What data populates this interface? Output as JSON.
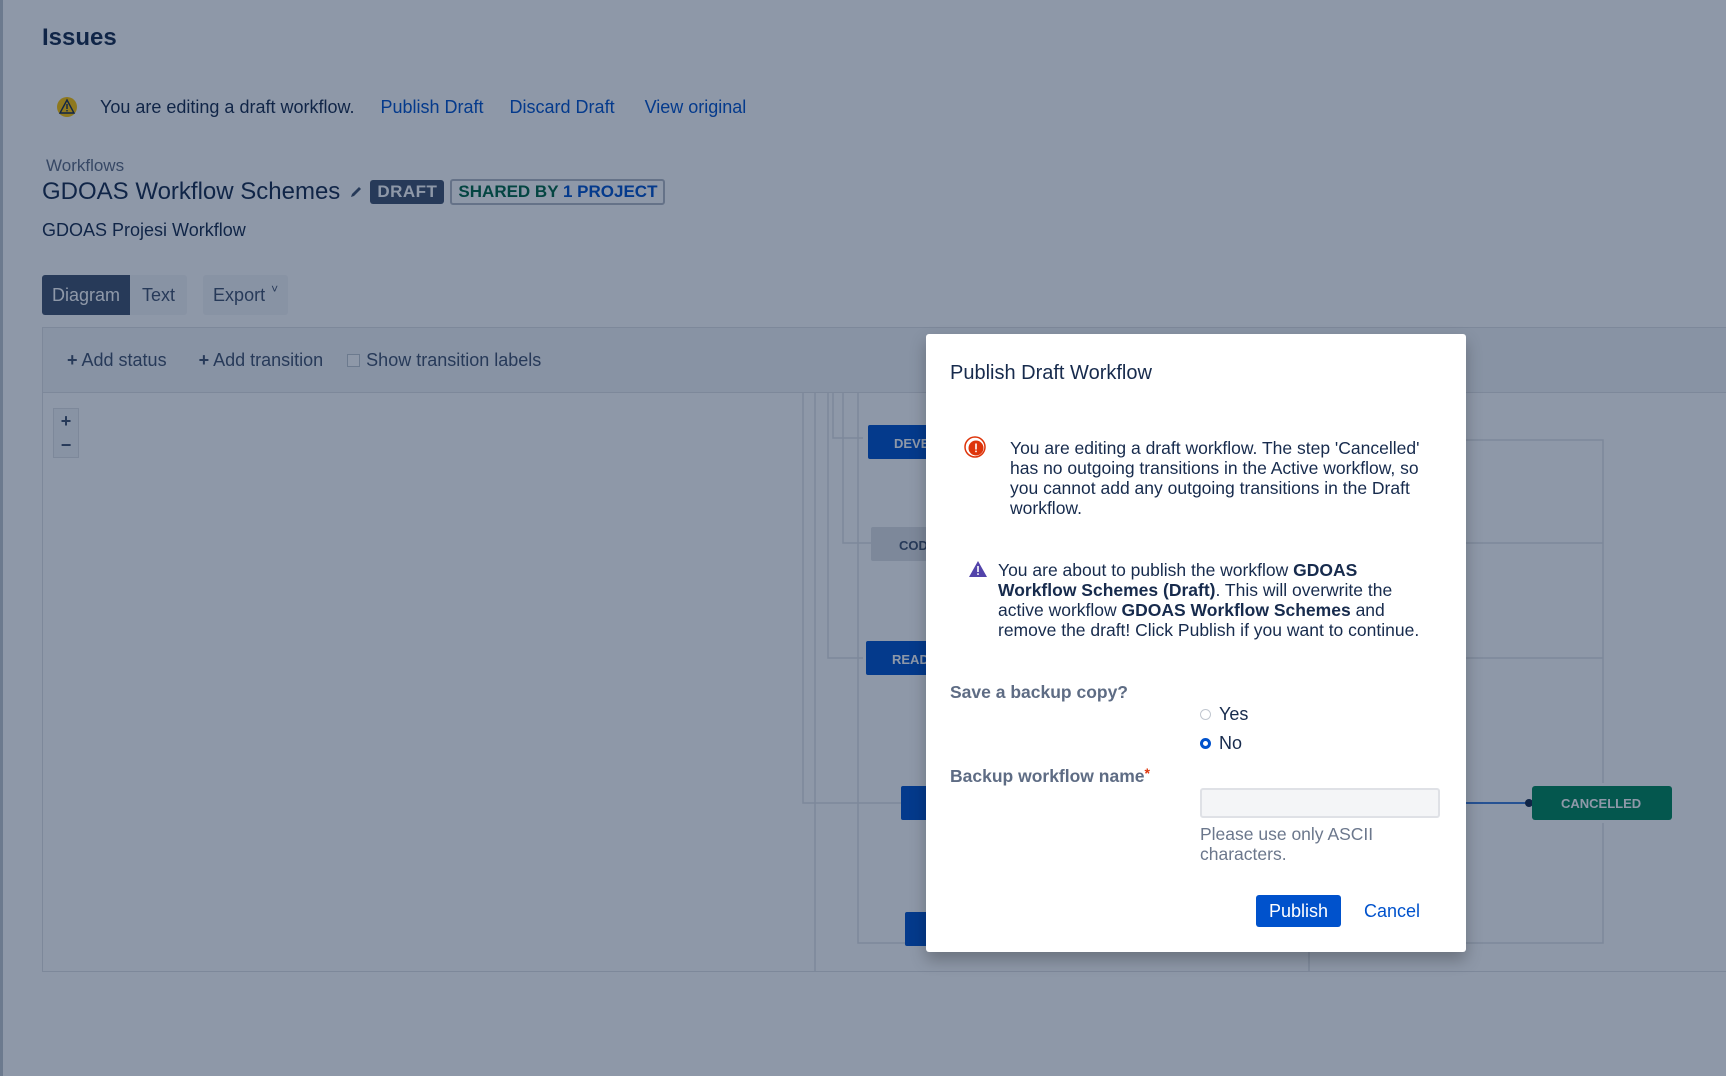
{
  "page": {
    "title": "Issues"
  },
  "draft_notice": {
    "text": "You are editing a draft workflow.",
    "publish_link": "Publish Draft",
    "discard_link": "Discard Draft",
    "view_original_link": "View original"
  },
  "workflow": {
    "breadcrumb": "Workflows",
    "title": "GDOAS Workflow Schemes",
    "draft_badge": "DRAFT",
    "shared_prefix": "SHARED BY",
    "shared_count": "1 PROJECT",
    "description": "GDOAS Projesi Workflow"
  },
  "tabs": {
    "diagram": "Diagram",
    "text": "Text",
    "export": "Export"
  },
  "toolbar": {
    "add_status": "Add status",
    "add_transition": "Add transition",
    "show_transition_labels": "Show transition labels"
  },
  "zoom": {
    "in": "+",
    "out": "−"
  },
  "diagram": {
    "statuses": {
      "dev": "DEVE",
      "code": "COD",
      "ready": "READ",
      "cancelled": "CANCELLED"
    }
  },
  "dialog": {
    "title": "Publish Draft Workflow",
    "error_message": "You are editing a draft workflow. The step 'Cancelled' has no outgoing transitions in the Active workflow, so you cannot add any outgoing transitions in the Draft workflow.",
    "warning_part1": "You are about to publish the workflow ",
    "warning_bold1": "GDOAS Workflow Schemes (Draft)",
    "warning_part2": ". This will overwrite the active workflow ",
    "warning_bold2": "GDOAS Workflow Schemes",
    "warning_part3": " and remove the draft! Click Publish if you want to continue.",
    "backup_label": "Save a backup copy?",
    "option_yes": "Yes",
    "option_no": "No",
    "selected_option": "No",
    "backup_name_label": "Backup workflow name",
    "required_marker": "*",
    "backup_name_value": "",
    "help_text": "Please use only ASCII characters.",
    "publish_button": "Publish",
    "cancel_button": "Cancel"
  },
  "colors": {
    "link": "#0052cc",
    "primary_button": "#0052cc",
    "status_blue": "#0052cc",
    "status_grey": "#dfe1e6",
    "status_green": "#00875a",
    "draft_badge": "#42526e",
    "error": "#de350b",
    "warning_purple": "#5243aa"
  }
}
